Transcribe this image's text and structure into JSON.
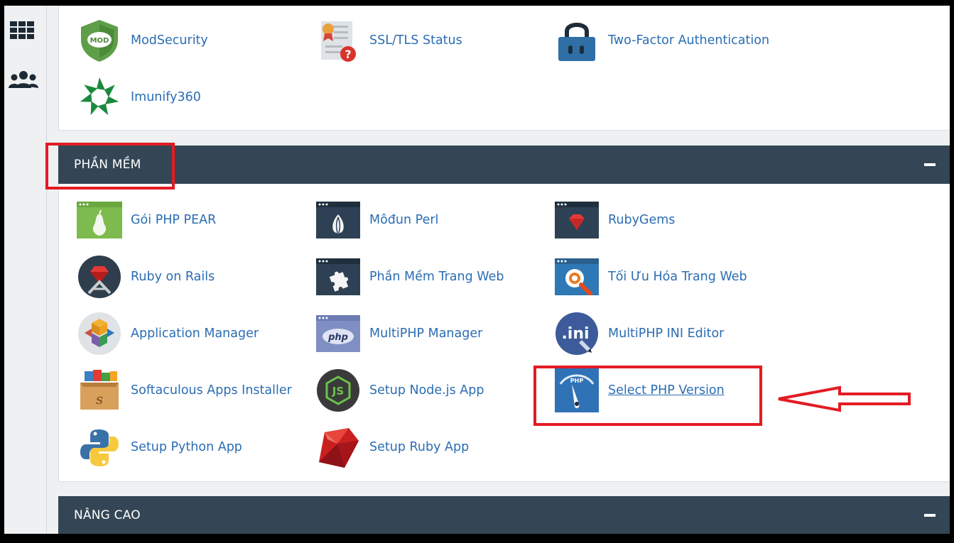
{
  "sidebar": {
    "icons": [
      "apps-grid-icon",
      "users-icon"
    ]
  },
  "security": {
    "items": [
      {
        "label": "ModSecurity",
        "icon": "modsecurity-shield-icon"
      },
      {
        "label": "SSL/TLS Status",
        "icon": "certificate-status-icon"
      },
      {
        "label": "Two-Factor Authentication",
        "icon": "padlock-icon"
      },
      {
        "label": "Imunify360",
        "icon": "imunify-star-icon"
      }
    ]
  },
  "software": {
    "title": "PHẦN MỀM",
    "items": [
      {
        "label": "Gói PHP PEAR",
        "icon": "pear-icon"
      },
      {
        "label": "Môđun Perl",
        "icon": "perl-onion-icon"
      },
      {
        "label": "RubyGems",
        "icon": "ruby-gem-icon"
      },
      {
        "label": "Ruby on Rails",
        "icon": "rails-icon"
      },
      {
        "label": "Phần Mềm Trang Web",
        "icon": "puzzle-icon"
      },
      {
        "label": "Tối Ưu Hóa Trang Web",
        "icon": "optimize-magnifier-icon"
      },
      {
        "label": "Application Manager",
        "icon": "app-cubes-icon"
      },
      {
        "label": "MultiPHP Manager",
        "icon": "php-window-icon"
      },
      {
        "label": "MultiPHP INI Editor",
        "icon": "ini-editor-icon"
      },
      {
        "label": "Softaculous Apps Installer",
        "icon": "softaculous-box-icon"
      },
      {
        "label": "Setup Node.js App",
        "icon": "nodejs-icon"
      },
      {
        "label": "Select PHP Version",
        "icon": "php-gauge-icon"
      },
      {
        "label": "Setup Python App",
        "icon": "python-icon"
      },
      {
        "label": "Setup Ruby App",
        "icon": "ruby-icon"
      }
    ]
  },
  "advanced": {
    "title": "NÂNG CAO"
  },
  "colors": {
    "header": "#344655",
    "link": "#2b6db3",
    "highlight": "#e31b23"
  }
}
